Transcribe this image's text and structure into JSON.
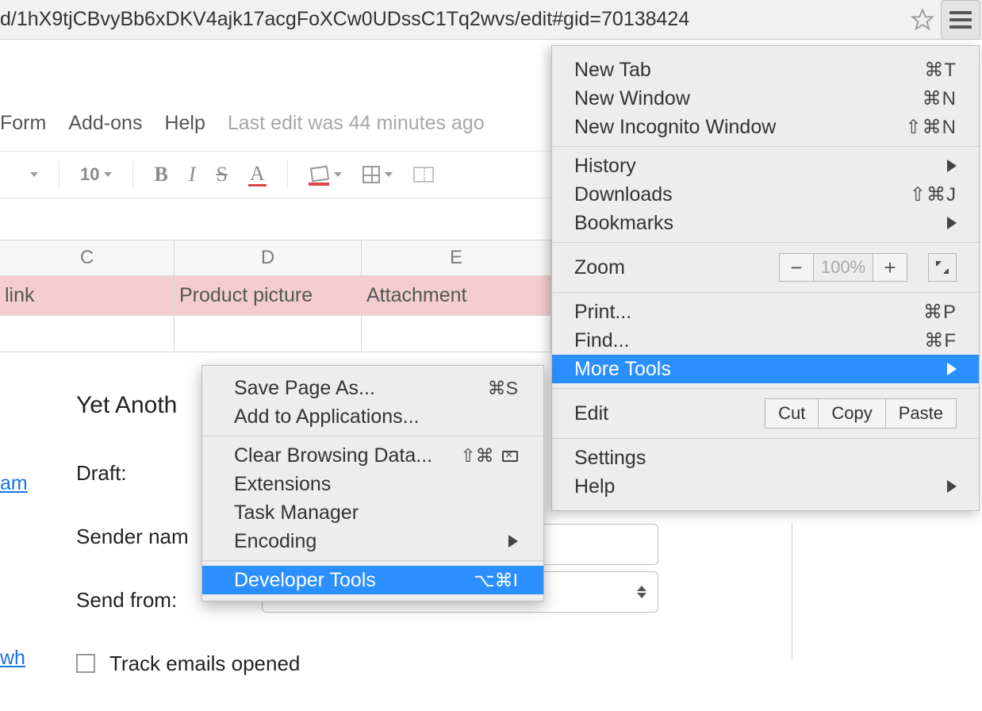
{
  "address_bar": {
    "url": "d/1hX9tjCBvyBb6xDKV4ajk17acgFoXCw0UDssC1Tq2wvs/edit#gid=70138424"
  },
  "sheets": {
    "menu": {
      "form": "Form",
      "addons": "Add-ons",
      "help": "Help",
      "last_edit": "Last edit was 44 minutes ago"
    },
    "toolbar": {
      "font_size": "10",
      "bold": "B",
      "italic": "I",
      "strike": "S",
      "textcolor": "A"
    },
    "columns": {
      "c": "C",
      "d": "D",
      "e": "E"
    },
    "header_row": {
      "c": "link",
      "d": "Product picture",
      "e": "Attachment"
    }
  },
  "panel": {
    "title_fragment": "Yet Anoth",
    "draft": "Draft:",
    "sender": "Sender nam",
    "sendfrom": "Send from:",
    "track": "Track emails opened",
    "link1": "am",
    "link2": "wh"
  },
  "chrome_menu": {
    "new_tab": {
      "label": "New Tab",
      "shortcut": "⌘T"
    },
    "new_window": {
      "label": "New Window",
      "shortcut": "⌘N"
    },
    "new_incognito": {
      "label": "New Incognito Window",
      "shortcut": "⇧⌘N"
    },
    "history": {
      "label": "History"
    },
    "downloads": {
      "label": "Downloads",
      "shortcut": "⇧⌘J"
    },
    "bookmarks": {
      "label": "Bookmarks"
    },
    "zoom": {
      "label": "Zoom",
      "value": "100%"
    },
    "print": {
      "label": "Print...",
      "shortcut": "⌘P"
    },
    "find": {
      "label": "Find...",
      "shortcut": "⌘F"
    },
    "more_tools": {
      "label": "More Tools"
    },
    "edit": {
      "label": "Edit",
      "cut": "Cut",
      "copy": "Copy",
      "paste": "Paste"
    },
    "settings": {
      "label": "Settings"
    },
    "help": {
      "label": "Help"
    }
  },
  "more_tools_menu": {
    "save_as": {
      "label": "Save Page As...",
      "shortcut": "⌘S"
    },
    "add_app": {
      "label": "Add to Applications..."
    },
    "clear": {
      "label": "Clear Browsing Data...",
      "shortcut": "⇧⌘"
    },
    "extensions": {
      "label": "Extensions"
    },
    "taskmgr": {
      "label": "Task Manager"
    },
    "encoding": {
      "label": "Encoding"
    },
    "devtools": {
      "label": "Developer Tools",
      "shortcut": "⌥⌘I"
    }
  }
}
